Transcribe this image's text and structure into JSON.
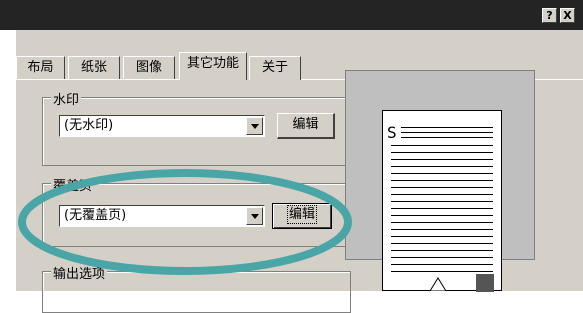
{
  "window": {
    "help_label": "?",
    "close_label": "X"
  },
  "tabs": [
    {
      "label": "布局"
    },
    {
      "label": "纸张"
    },
    {
      "label": "图像"
    },
    {
      "label": "其它功能",
      "active": true
    },
    {
      "label": "关于"
    }
  ],
  "watermark": {
    "group_label": "水印",
    "selected": "(无水印)",
    "edit_label": "编辑"
  },
  "overlay": {
    "group_label": "覆盖页",
    "selected": "(无覆盖页)",
    "edit_label": "编辑"
  },
  "output_options": {
    "group_label": "输出选项"
  },
  "preview": {
    "page_letter": "S"
  },
  "annotation": {
    "color": "#4aa6a6",
    "icon": "cursor-arrow-icon"
  }
}
